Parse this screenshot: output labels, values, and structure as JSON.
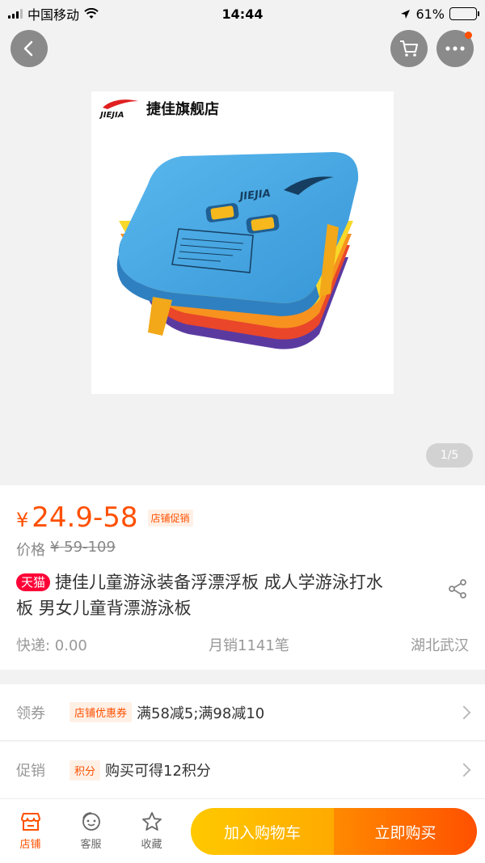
{
  "status_bar": {
    "carrier": "中国移动",
    "time": "14:44",
    "battery": "61%"
  },
  "gallery": {
    "store_name": "捷佳旗舰店",
    "brand_logo": "JIEJIA",
    "page": "1/5"
  },
  "product": {
    "price_symbol": "¥",
    "price": "24.9-58",
    "promo_tag": "店铺促销",
    "orig_label": "价格",
    "orig_price": "¥ 59-109",
    "tmall_badge": "天猫",
    "title": "捷佳儿童游泳装备浮漂浮板 成人学游泳打水板 男女儿童背漂游泳板",
    "shipping": "快递: 0.00",
    "monthly_sales": "月销1141笔",
    "location": "湖北武汉"
  },
  "coupon_row": {
    "label": "领券",
    "tag": "店铺优惠券",
    "text": "满58减5;满98减10"
  },
  "promo_row": {
    "label": "促销",
    "tag": "积分",
    "text": "购买可得12积分"
  },
  "bottom_bar": {
    "store_label": "店铺",
    "service_label": "客服",
    "favorite_label": "收藏",
    "add_cart_label": "加入购物车",
    "buy_now_label": "立即购买"
  },
  "colors": {
    "accent": "#ff5000",
    "tmall": "#ff0036",
    "cart_button": "#ffb400"
  }
}
